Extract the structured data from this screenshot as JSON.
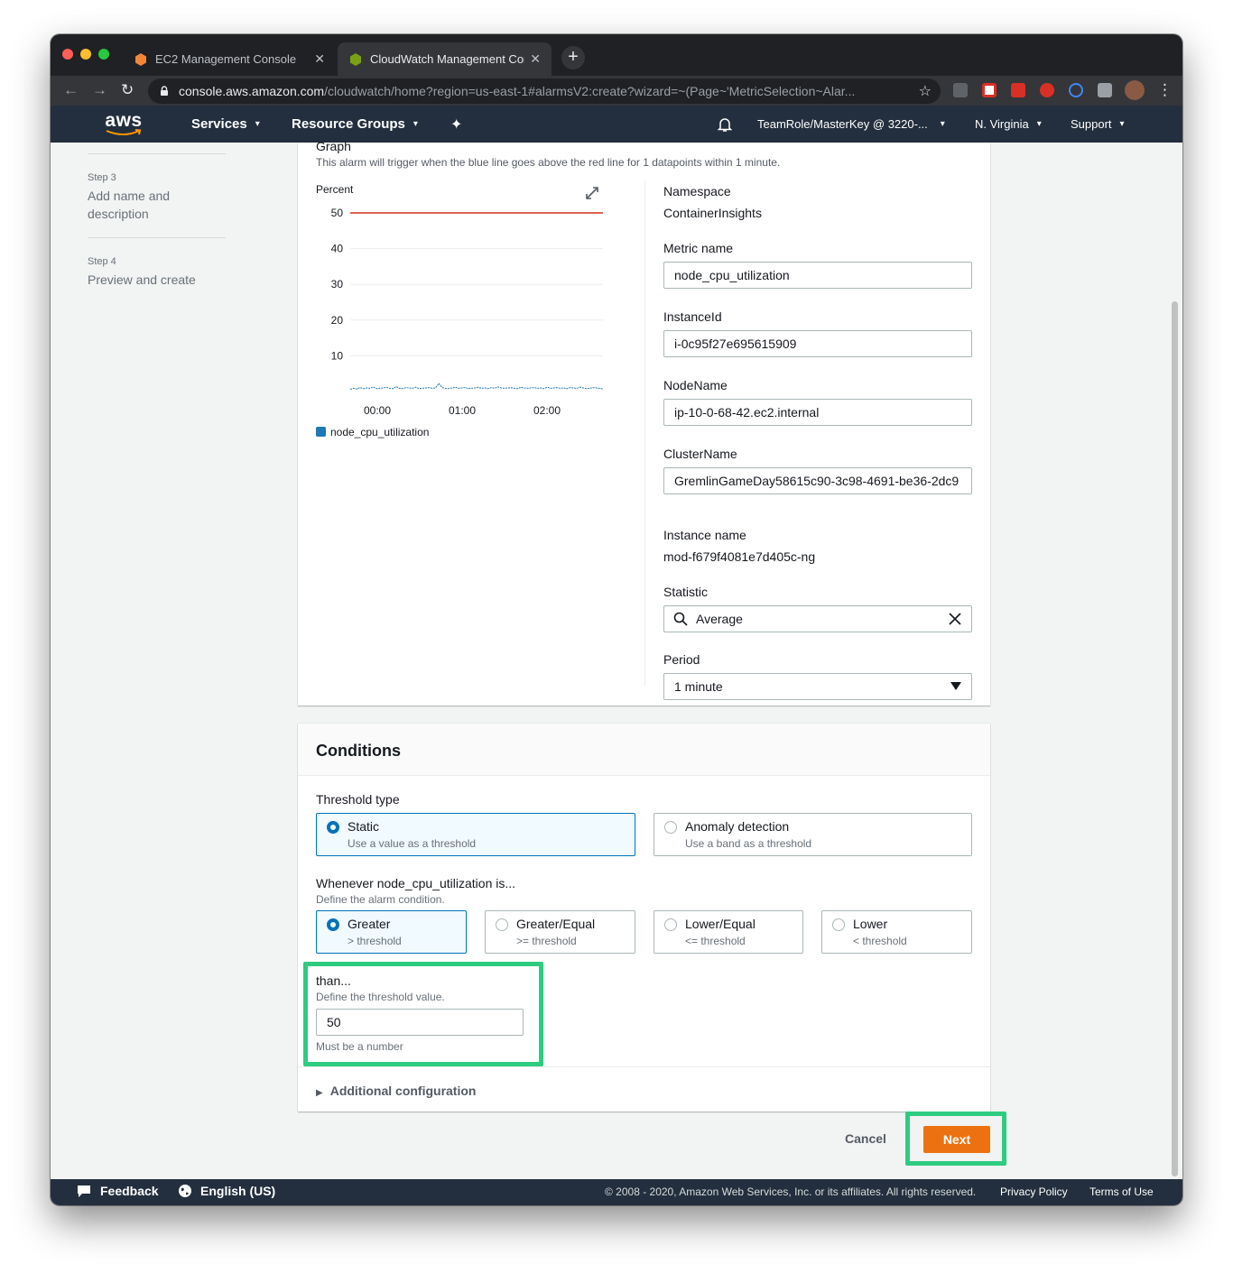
{
  "browser": {
    "tabs": [
      {
        "title": "EC2 Management Console",
        "active": false
      },
      {
        "title": "CloudWatch Management Cons",
        "active": true
      }
    ],
    "url_host": "console.aws.amazon.com",
    "url_path": "/cloudwatch/home?region=us-east-1#alarmsV2:create?wizard=~(Page~'MetricSelection~Alar..."
  },
  "nav": {
    "logo": "aws",
    "services": "Services",
    "resource_groups": "Resource Groups",
    "account": "TeamRole/MasterKey @ 3220-...",
    "region": "N. Virginia",
    "support": "Support"
  },
  "steps": [
    {
      "num": "Step 3",
      "label": "Add name and description"
    },
    {
      "num": "Step 4",
      "label": "Preview and create"
    }
  ],
  "graph": {
    "title": "Graph",
    "description": "This alarm will trigger when the blue line goes above the red line for 1 datapoints within 1 minute."
  },
  "chart_data": {
    "type": "line",
    "ylabel": "Percent",
    "ylim": [
      0,
      50
    ],
    "yticks": [
      10,
      20,
      30,
      40,
      50
    ],
    "x_ticks": [
      "00:00",
      "01:00",
      "02:00"
    ],
    "threshold": 50,
    "threshold_color": "#d13212",
    "series": [
      {
        "name": "node_cpu_utilization",
        "color": "#1f77b4",
        "values": [
          0.6,
          0.9,
          0.7,
          1.1,
          0.8,
          1.0,
          0.9,
          1.3,
          0.8,
          0.9,
          1.0,
          1.2,
          0.9,
          0.8,
          1.4,
          0.9,
          0.8,
          1.1,
          1.0,
          0.9,
          1.2,
          0.8,
          0.9,
          1.0,
          1.1,
          0.9,
          1.0,
          2.3,
          1.1,
          0.9,
          0.8,
          1.0,
          1.2,
          0.9,
          1.0,
          1.1,
          0.8,
          0.9,
          1.0,
          1.2,
          0.9,
          1.0,
          0.8,
          1.1,
          0.9,
          1.3,
          1.0,
          0.9,
          1.0,
          1.1,
          0.9,
          0.8,
          1.2,
          1.0,
          0.9,
          1.0,
          1.1,
          0.9,
          1.0,
          0.8,
          1.2,
          0.9,
          1.0,
          1.1,
          0.9,
          1.0,
          0.8,
          1.1,
          1.0,
          0.9,
          1.2,
          1.0,
          0.8,
          0.9,
          1.1,
          1.0,
          0.9,
          0.7
        ]
      }
    ]
  },
  "metric": {
    "namespace_label": "Namespace",
    "namespace_value": "ContainerInsights",
    "metric_name_label": "Metric name",
    "metric_name_value": "node_cpu_utilization",
    "instanceid_label": "InstanceId",
    "instanceid_value": "i-0c95f27e695615909",
    "nodename_label": "NodeName",
    "nodename_value": "ip-10-0-68-42.ec2.internal",
    "clustername_label": "ClusterName",
    "clustername_value": "GremlinGameDay58615c90-3c98-4691-be36-2dc9",
    "instance_name_label": "Instance name",
    "instance_name_value": "mod-f679f4081e7d405c-ng",
    "statistic_label": "Statistic",
    "statistic_value": "Average",
    "period_label": "Period",
    "period_value": "1 minute"
  },
  "conditions": {
    "title": "Conditions",
    "threshold_type_label": "Threshold type",
    "threshold_types": [
      {
        "label": "Static",
        "desc": "Use a value as a threshold",
        "selected": true
      },
      {
        "label": "Anomaly detection",
        "desc": "Use a band as a threshold",
        "selected": false
      }
    ],
    "whenever_label": "Whenever node_cpu_utilization is...",
    "whenever_desc": "Define the alarm condition.",
    "operators": [
      {
        "label": "Greater",
        "desc": "> threshold",
        "selected": true
      },
      {
        "label": "Greater/Equal",
        "desc": ">= threshold",
        "selected": false
      },
      {
        "label": "Lower/Equal",
        "desc": "<= threshold",
        "selected": false
      },
      {
        "label": "Lower",
        "desc": "< threshold",
        "selected": false
      }
    ],
    "than_label": "than...",
    "than_desc": "Define the threshold value.",
    "threshold_value": "50",
    "threshold_hint": "Must be a number",
    "additional_config": "Additional configuration"
  },
  "actions": {
    "cancel": "Cancel",
    "next": "Next"
  },
  "footer": {
    "feedback": "Feedback",
    "language": "English (US)",
    "copyright": "© 2008 - 2020, Amazon Web Services, Inc. or its affiliates. All rights reserved.",
    "privacy": "Privacy Policy",
    "terms": "Terms of Use"
  },
  "colors": {
    "accent": "#0073bb",
    "next_button": "#ec7211",
    "highlight": "#2ecc80",
    "nav_bg": "#232f3e"
  }
}
